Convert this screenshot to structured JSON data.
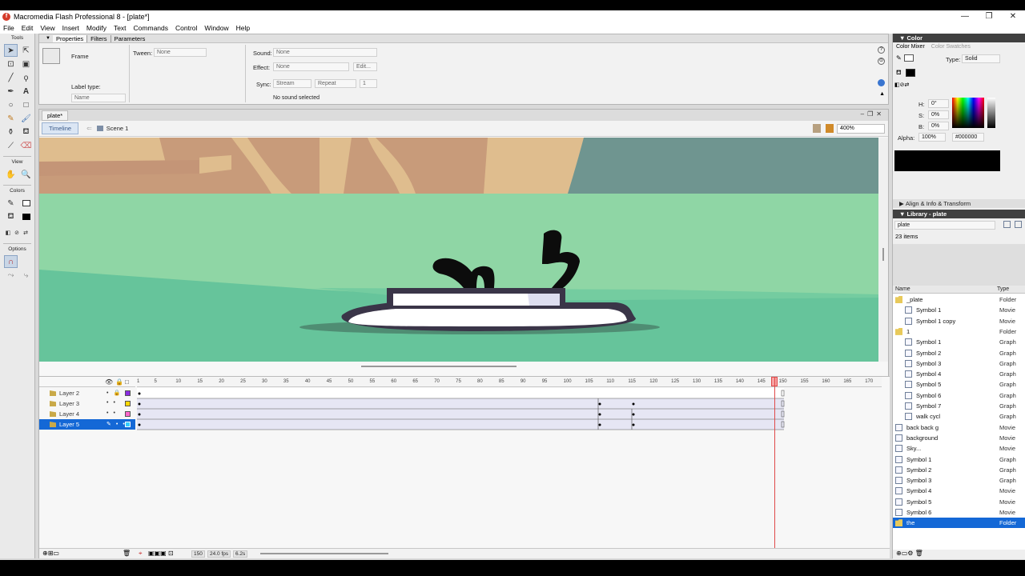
{
  "window": {
    "title": "Macromedia Flash Professional 8 - [plate*]",
    "app_icon_letter": "f",
    "controls": [
      "—",
      "❐",
      "✕"
    ]
  },
  "menu": [
    "File",
    "Edit",
    "View",
    "Insert",
    "Modify",
    "Text",
    "Commands",
    "Control",
    "Window",
    "Help"
  ],
  "tools": {
    "header": "Tools",
    "view_header": "View",
    "colors_header": "Colors",
    "options_header": "Options",
    "items": [
      "arrow-icon",
      "subselect-icon",
      "free-transform-icon",
      "fill-transform-icon",
      "line-icon",
      "lasso-icon",
      "pen-icon",
      "text-icon",
      "oval-icon",
      "rectangle-icon",
      "pencil-icon",
      "brush-icon",
      "ink-bottle-icon",
      "paint-bucket-icon",
      "eyedropper-icon",
      "eraser-icon"
    ]
  },
  "properties": {
    "tabs": [
      "Properties",
      "Filters",
      "Parameters"
    ],
    "frame_label": "Frame",
    "tween_label": "Tween:",
    "tween_value": "None",
    "sound_label": "Sound:",
    "sound_value": "None",
    "effect_label": "Effect:",
    "effect_value": "None",
    "edit_button": "Edit...",
    "sync_label": "Sync:",
    "sync_value": "Stream",
    "repeat_value": "Repeat",
    "repeat_count": "1",
    "label_type_label": "Label type:",
    "label_type_value": "Name",
    "no_sound": "No sound selected"
  },
  "document": {
    "tab": "plate*",
    "timeline_button": "Timeline",
    "scene": "Scene 1",
    "zoom": "400%"
  },
  "timeline": {
    "ruler_ticks": [
      "1",
      "5",
      "10",
      "15",
      "20",
      "25",
      "30",
      "35",
      "40",
      "45",
      "50",
      "55",
      "60",
      "65",
      "70",
      "75",
      "80",
      "85",
      "90",
      "95",
      "100",
      "105",
      "110",
      "115",
      "120",
      "125",
      "130",
      "135",
      "140",
      "145",
      "150",
      "155",
      "160",
      "165",
      "170"
    ],
    "layers": [
      {
        "name": "Layer 2",
        "color": "#8a2be2"
      },
      {
        "name": "Layer 3",
        "color": "#ffd700"
      },
      {
        "name": "Layer 4",
        "color": "#ff66cc"
      },
      {
        "name": "Layer 5",
        "color": "#33ccff"
      }
    ],
    "current_frame": "150",
    "fps": "24.0 fps",
    "time": "6.2s"
  },
  "color_panel": {
    "header": "Color",
    "tabs": [
      "Color Mixer",
      "Color Swatches"
    ],
    "type_label": "Type:",
    "type_value": "Solid",
    "h_label": "H:",
    "h_value": "0°",
    "s_label": "S:",
    "s_value": "0%",
    "b_label": "B:",
    "b_value": "0%",
    "alpha_label": "Alpha:",
    "alpha_value": "100%",
    "hex": "#000000",
    "preview_color": "#000000"
  },
  "align_header": "Align & Info & Transform",
  "library": {
    "header": "Library - plate",
    "dropdown": "plate",
    "count": "23 items",
    "col_name": "Name",
    "col_type": "Type",
    "items": [
      {
        "name": "_plate",
        "type": "Folder",
        "indent": 0,
        "icon": "folder"
      },
      {
        "name": "Symbol 1",
        "type": "Movie",
        "indent": 1,
        "icon": "symbol"
      },
      {
        "name": "Symbol 1 copy",
        "type": "Movie",
        "indent": 1,
        "icon": "symbol"
      },
      {
        "name": "1",
        "type": "Folder",
        "indent": 0,
        "icon": "folder"
      },
      {
        "name": "Symbol 1",
        "type": "Graph",
        "indent": 1,
        "icon": "symbol"
      },
      {
        "name": "Symbol 2",
        "type": "Graph",
        "indent": 1,
        "icon": "symbol"
      },
      {
        "name": "Symbol 3",
        "type": "Graph",
        "indent": 1,
        "icon": "symbol"
      },
      {
        "name": "Symbol 4",
        "type": "Graph",
        "indent": 1,
        "icon": "symbol"
      },
      {
        "name": "Symbol 5",
        "type": "Graph",
        "indent": 1,
        "icon": "symbol"
      },
      {
        "name": "Symbol 6",
        "type": "Graph",
        "indent": 1,
        "icon": "symbol"
      },
      {
        "name": "Symbol 7",
        "type": "Graph",
        "indent": 1,
        "icon": "symbol"
      },
      {
        "name": "walk cycl",
        "type": "Graph",
        "indent": 1,
        "icon": "symbol"
      },
      {
        "name": "back back g",
        "type": "Movie",
        "indent": 0,
        "icon": "symbol"
      },
      {
        "name": "background",
        "type": "Movie",
        "indent": 0,
        "icon": "symbol"
      },
      {
        "name": "Sky...",
        "type": "Movie",
        "indent": 0,
        "icon": "symbol"
      },
      {
        "name": "Symbol 1",
        "type": "Graph",
        "indent": 0,
        "icon": "symbol"
      },
      {
        "name": "Symbol 2",
        "type": "Graph",
        "indent": 0,
        "icon": "symbol"
      },
      {
        "name": "Symbol 3",
        "type": "Graph",
        "indent": 0,
        "icon": "symbol"
      },
      {
        "name": "Symbol 4",
        "type": "Movie",
        "indent": 0,
        "icon": "symbol"
      },
      {
        "name": "Symbol 5",
        "type": "Movie",
        "indent": 0,
        "icon": "symbol"
      },
      {
        "name": "Symbol 6",
        "type": "Movie",
        "indent": 0,
        "icon": "symbol"
      },
      {
        "name": "the",
        "type": "Folder",
        "indent": 0,
        "icon": "folder",
        "selected": true
      }
    ]
  }
}
